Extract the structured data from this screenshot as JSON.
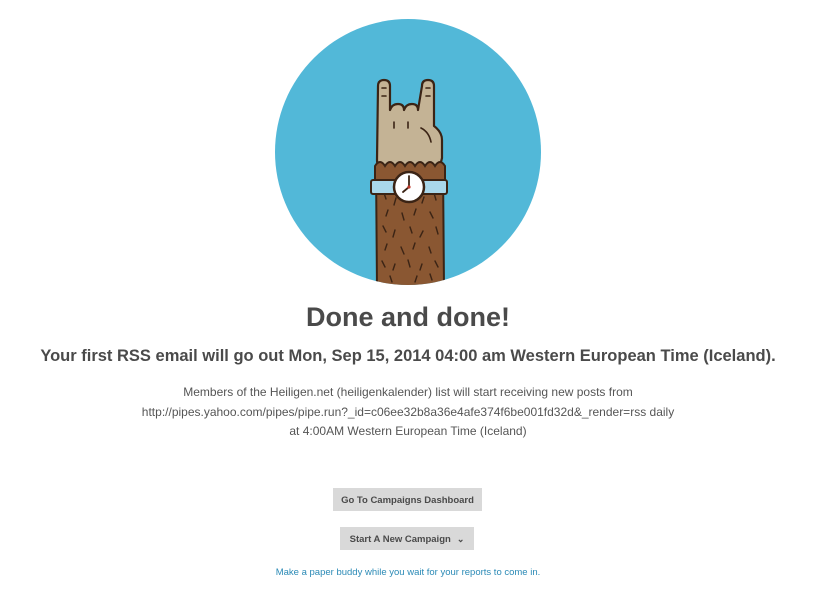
{
  "hero": {
    "illustration": "hand-rock-gesture-with-watch",
    "circle_color": "#52b8d8"
  },
  "title": "Done and done!",
  "subtitle": "Your first RSS email will go out Mon, Sep 15, 2014 04:00 am Western European Time (Iceland).",
  "description": {
    "line1": "Members of the Heiligen.net (heiligenkalender) list will start receiving new posts from",
    "line2": "http://pipes.yahoo.com/pipes/pipe.run?_id=c06ee32b8a36e4afe374f6be001fd32d&_render=rss daily",
    "line3": "at 4:00AM Western European Time (Iceland)"
  },
  "buttons": {
    "dashboard_label": "Go To Campaigns Dashboard",
    "new_campaign_label": "Start A New Campaign"
  },
  "link_text": "Make a paper buddy while you wait for your reports to come in.",
  "colors": {
    "button_bg": "#d9d9d9",
    "link": "#2b8ab6",
    "text": "#4a4a4a"
  }
}
